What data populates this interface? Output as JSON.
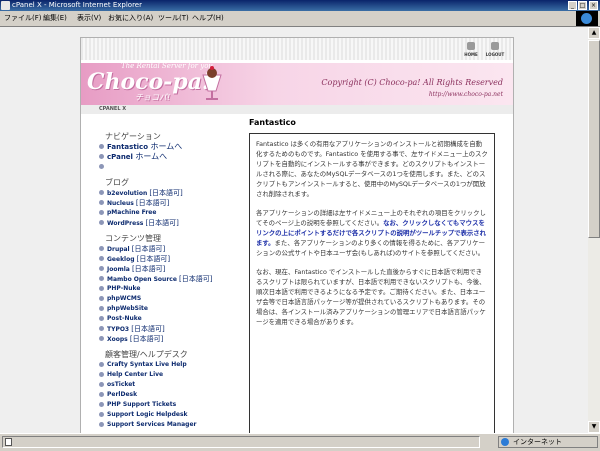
{
  "window": {
    "title": "cPanel X - Microsoft Internet Explorer"
  },
  "menu": {
    "items": [
      "ファイル(F)",
      "編集(E)",
      "表示(V)",
      "お気に入り(A)",
      "ツール(T)",
      "ヘルプ(H)"
    ]
  },
  "topbar": {
    "home_label": "HOME",
    "logout_label": "LOGOUT"
  },
  "banner": {
    "tagline": "The Rental Server for you",
    "logo": "Choco-pa!",
    "logo_jp": "チョコパ!",
    "copyright": "Copyright (C) Choco-pa! All Rights Reserved",
    "url": "http://www.choco-pa.net"
  },
  "breadcrumb": "CPANEL X",
  "sidebar": {
    "navigation": {
      "title": "ナビゲーション",
      "items": [
        {
          "name": "Fantastico",
          "jp": "ホームへ"
        },
        {
          "name": "cPanel",
          "jp": "ホームへ"
        },
        {
          "name": "",
          "jp": ""
        }
      ]
    },
    "blog": {
      "title": "ブログ",
      "items": [
        {
          "name": "b2evolution",
          "jp": "[日本語可]"
        },
        {
          "name": "Nucleus",
          "jp": "[日本語可]"
        },
        {
          "name": "pMachine Free",
          "jp": ""
        },
        {
          "name": "WordPress",
          "jp": "[日本語可]"
        }
      ]
    },
    "cms": {
      "title": "コンテンツ管理",
      "items": [
        {
          "name": "Drupal",
          "jp": "[日本語可]"
        },
        {
          "name": "Geeklog",
          "jp": "[日本語可]"
        },
        {
          "name": "Joomla",
          "jp": "[日本語可]"
        },
        {
          "name": "Mambo Open Source",
          "jp": "[日本語可]"
        },
        {
          "name": "PHP-Nuke",
          "jp": ""
        },
        {
          "name": "phpWCMS",
          "jp": ""
        },
        {
          "name": "phpWebSite",
          "jp": ""
        },
        {
          "name": "Post-Nuke",
          "jp": ""
        },
        {
          "name": "TYPO3",
          "jp": "[日本語可]"
        },
        {
          "name": "Xoops",
          "jp": "[日本語可]"
        }
      ]
    },
    "helpdesk": {
      "title": "顧客管理/ヘルプデスク",
      "items": [
        {
          "name": "Crafty Syntax Live Help",
          "jp": ""
        },
        {
          "name": "Help Center Live",
          "jp": ""
        },
        {
          "name": "osTicket",
          "jp": ""
        },
        {
          "name": "PerlDesk",
          "jp": ""
        },
        {
          "name": "PHP Support Tickets",
          "jp": ""
        },
        {
          "name": "Support Logic Helpdesk",
          "jp": ""
        },
        {
          "name": "Support Services Manager",
          "jp": ""
        }
      ]
    }
  },
  "main": {
    "title": "Fantastico",
    "para1": "Fantastico は多くの有用なアプリケーションのインストールと初期構成を自動化するためのものです。Fantastico を使用する事で、左サイドメニュー上のスクリプトを自動的にインストールする事ができます。どのスクリプトもインストールされる際に、あなたのMySQLデータベースの1つを使用します。また、どのスクリプトもアンインストールすると、使用中のMySQLデータベースの1つが開放され削除されます。",
    "para2_a": "各アプリケーションの詳細は左サイドメニュー上のそれぞれの項目をクリックしてそのページ上の説明を参照してください。",
    "para2_b": "なお、クリックしなくてもマウスをリンクの上にポイントするだけで各スクリプトの説明がツールチップで表示されます。",
    "para2_c": "また、各アプリケーションのより多くの情報を得るために、各アプリケーションの公式サイトや日本ユーザ会(もしあれば)のサイトを参照してください。",
    "para3": "なお、現在、Fantastico でインストールした直後からすぐに日本語で利用できるスクリプトは限られていますが、日本語で利用できないスクリプトも、今後、順次日本語で利用できるようになる予定です。ご期待ください。また、日本ユーザ会等で日本語言語パッケージ等が提供されているスクリプトもあります。その場合は、各インストール済みアプリケーションの管理エリアで日本語言語パッケージを適用できる場合があります。"
  },
  "status": {
    "text": "",
    "zone": "インターネット"
  }
}
